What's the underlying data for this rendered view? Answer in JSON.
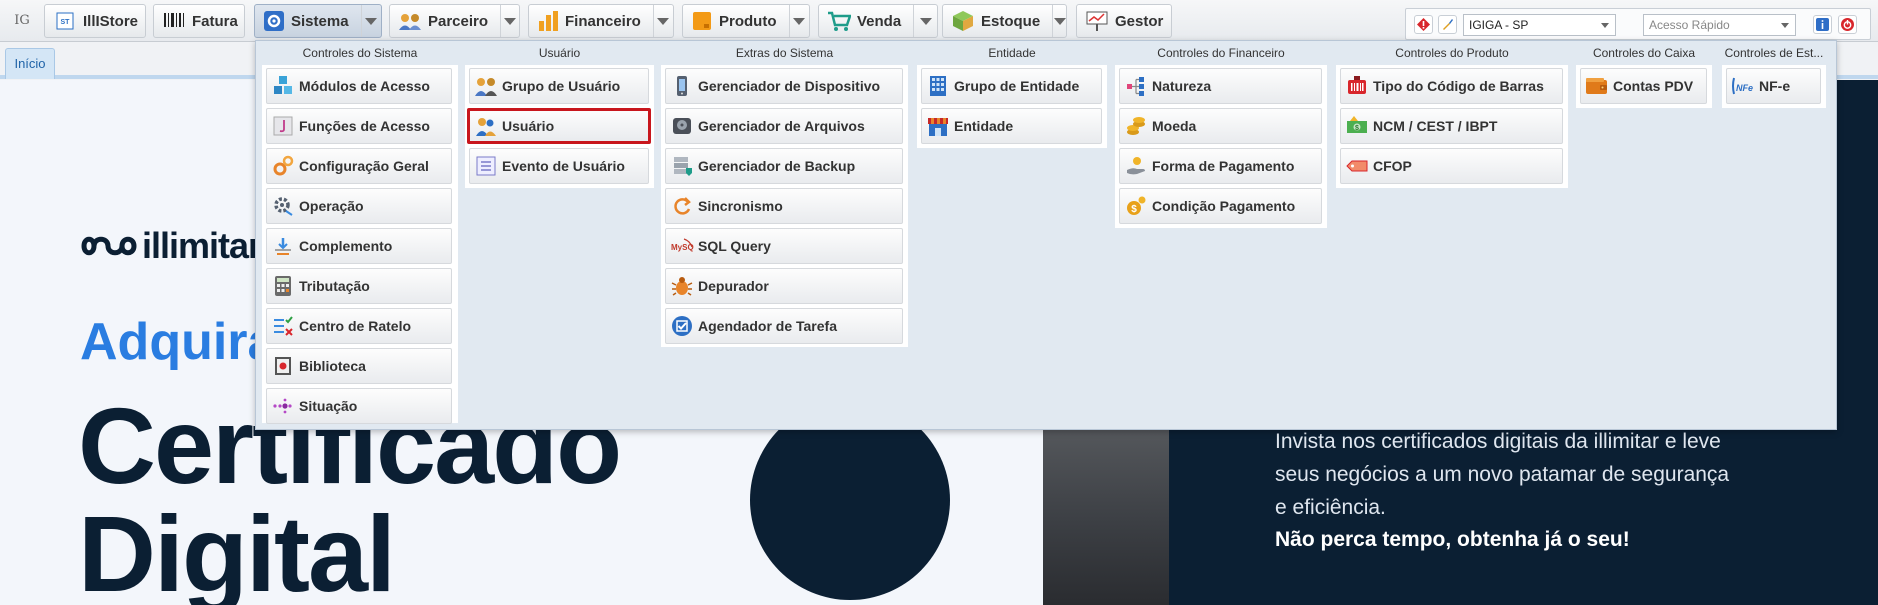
{
  "toolbar": {
    "home_label": "IG",
    "buttons": [
      {
        "label": "IllIStore"
      },
      {
        "label": "Fatura"
      },
      {
        "label": "Sistema"
      },
      {
        "label": "Parceiro"
      },
      {
        "label": "Financeiro"
      },
      {
        "label": "Produto"
      },
      {
        "label": "Venda"
      },
      {
        "label": "Estoque"
      },
      {
        "label": "Gestor"
      }
    ]
  },
  "right_panel": {
    "company_select": "IGIGA - SP",
    "quick_access_placeholder": "Acesso Rápido"
  },
  "tabs": [
    {
      "label": "Início"
    }
  ],
  "banner": {
    "logo_text": "illimitar",
    "headline_a": "Adquira",
    "headline_b_line1": "Certificado",
    "headline_b_line2": "Digital",
    "promo_line1": "Invista nos certificados digitais da illimitar e leve",
    "promo_line2": "seus negócios a um novo patamar de segurança",
    "promo_line3": "e eficiência.",
    "promo_cta": "Não perca tempo, obtenha já o seu!"
  },
  "menu": {
    "columns": [
      {
        "title": "Controles do Sistema",
        "items": [
          "Módulos de Acesso",
          "Funções de Acesso",
          "Configuração Geral",
          "Operação",
          "Complemento",
          "Tributação",
          "Centro de Ratelo",
          "Biblioteca",
          "Situação"
        ]
      },
      {
        "title": "Usuário",
        "items": [
          "Grupo de Usuário",
          "Usuário",
          "Evento de Usuário"
        ]
      },
      {
        "title": "Extras do Sistema",
        "items": [
          "Gerenciador de Dispositivo",
          "Gerenciador de Arquivos",
          "Gerenciador de Backup",
          "Sincronismo",
          "SQL Query",
          "Depurador",
          "Agendador de Tarefa"
        ]
      },
      {
        "title": "Entidade",
        "items": [
          "Grupo de Entidade",
          "Entidade"
        ]
      },
      {
        "title": "Controles do Financeiro",
        "items": [
          "Natureza",
          "Moeda",
          "Forma de Pagamento",
          "Condição Pagamento"
        ]
      },
      {
        "title": "Controles do Produto",
        "items": [
          "Tipo do Código de Barras",
          "NCM / CEST / IBPT",
          "CFOP"
        ]
      },
      {
        "title": "Controles do Caixa",
        "items": [
          "Contas PDV"
        ]
      },
      {
        "title": "Controles de Est...",
        "items": [
          "NF-e"
        ]
      }
    ],
    "selected_item": "Usuário"
  }
}
